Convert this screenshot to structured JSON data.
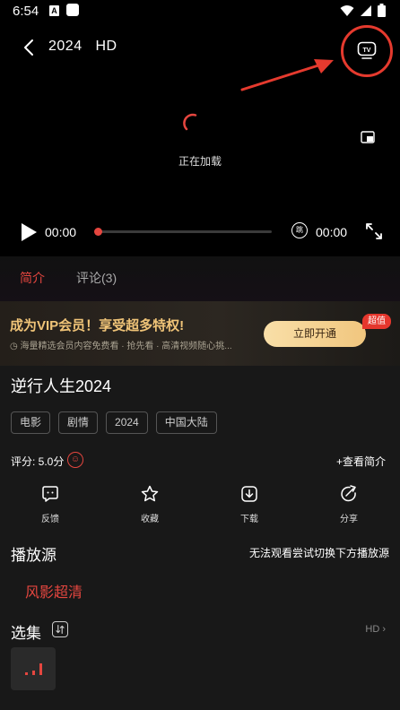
{
  "status": {
    "time": "6:54",
    "notif_icon": "A"
  },
  "player": {
    "title": "2024",
    "quality": "HD",
    "loading_text": "正在加载",
    "current_time": "00:00",
    "total_time": "00:00",
    "skip_label": "跳",
    "progress": 0,
    "accent_color": "#e5463f",
    "highlight_color": "#e53a2e"
  },
  "tabs": [
    {
      "label": "简介",
      "active": true
    },
    {
      "label": "评论(3)",
      "active": false
    }
  ],
  "vip": {
    "title": "成为VIP会员！享受超多特权!",
    "subtitle": "海量精选会员内容免费看 · 抢先看 · 高清视频随心挑...",
    "button": "立即开通",
    "badge": "超值"
  },
  "movie": {
    "title": "逆行人生2024",
    "tags": [
      "电影",
      "剧情",
      "2024",
      "中国大陆"
    ],
    "rating": "评分: 5.0分",
    "view_intro": "+查看简介"
  },
  "actions": [
    {
      "label": "反馈",
      "icon": "feedback-icon"
    },
    {
      "label": "收藏",
      "icon": "star-icon"
    },
    {
      "label": "下载",
      "icon": "download-icon"
    },
    {
      "label": "分享",
      "icon": "share-icon"
    }
  ],
  "source": {
    "title": "播放源",
    "hint": "无法观看尝试切换下方播放源",
    "selected": "风影超清"
  },
  "episodes": {
    "title": "选集",
    "quality": "HD"
  }
}
